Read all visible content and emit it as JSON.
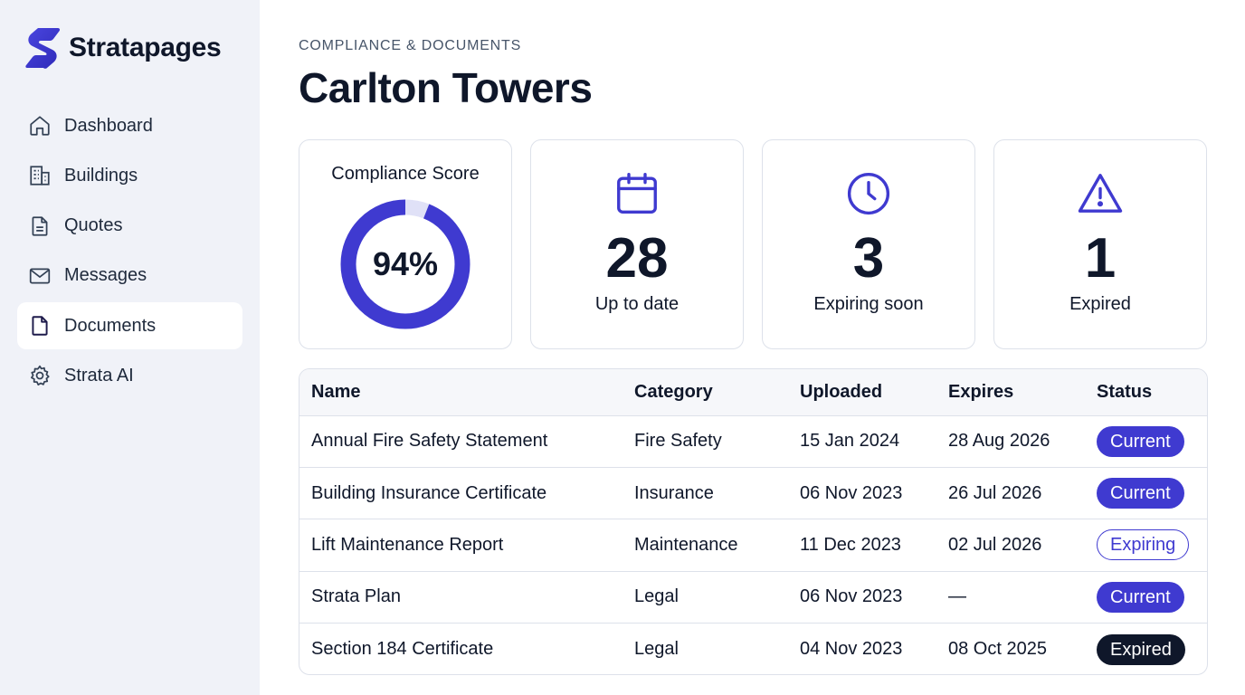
{
  "app": {
    "name": "Stratapages"
  },
  "sidebar": {
    "items": [
      {
        "label": "Dashboard",
        "icon": "home-icon",
        "active": false
      },
      {
        "label": "Buildings",
        "icon": "building-icon",
        "active": false
      },
      {
        "label": "Quotes",
        "icon": "document-text-icon",
        "active": false
      },
      {
        "label": "Messages",
        "icon": "mail-icon",
        "active": false
      },
      {
        "label": "Documents",
        "icon": "file-icon",
        "active": true
      },
      {
        "label": "Strata AI",
        "icon": "gear-icon",
        "active": false
      }
    ]
  },
  "header": {
    "eyebrow": "COMPLIANCE & DOCUMENTS",
    "title": "Carlton Towers"
  },
  "score": {
    "title": "Compliance Score",
    "value": "94%",
    "fraction": 0.94
  },
  "stats": [
    {
      "value": "28",
      "label": "Up to date",
      "icon": "calendar-icon"
    },
    {
      "value": "3",
      "label": "Expiring soon",
      "icon": "clock-icon"
    },
    {
      "value": "1",
      "label": "Expired",
      "icon": "warning-icon"
    }
  ],
  "table": {
    "headers": [
      "Name",
      "Category",
      "Uploaded",
      "Expires",
      "Status"
    ],
    "rows": [
      {
        "name": "Annual Fire Safety Statement",
        "category": "Fire Safety",
        "uploaded": "15 Jan 2024",
        "expires": "28 Aug 2026",
        "status": "Current"
      },
      {
        "name": "Building Insurance Certificate",
        "category": "Insurance",
        "uploaded": "06 Nov 2023",
        "expires": "26 Jul 2026",
        "status": "Current"
      },
      {
        "name": "Lift Maintenance Report",
        "category": "Maintenance",
        "uploaded": "11 Dec 2023",
        "expires": "02 Jul 2026",
        "status": "Expiring"
      },
      {
        "name": "Strata Plan",
        "category": "Legal",
        "uploaded": "06 Nov 2023",
        "expires": "—",
        "status": "Current"
      },
      {
        "name": "Section 184 Certificate",
        "category": "Legal",
        "uploaded": "04 Nov 2023",
        "expires": "08 Oct 2025",
        "status": "Expired"
      }
    ]
  },
  "colors": {
    "accent": "#3f3ad0",
    "ring_track": "#e0e1f7",
    "sidebar_bg": "#f0f2f8",
    "expired_badge": "#0f172a"
  }
}
